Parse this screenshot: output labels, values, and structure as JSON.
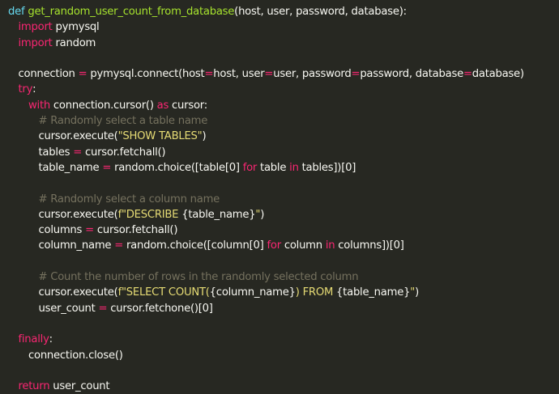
{
  "colors": {
    "background": "#272822",
    "plain": "#f8f8f2",
    "keyword": "#f92672",
    "function": "#a6e22e",
    "string": "#e6db74",
    "comment": "#75715e",
    "def_keyword": "#66d9ef"
  },
  "code": {
    "lines": [
      {
        "indent": 0,
        "tokens": [
          {
            "t": "def",
            "c": "def"
          },
          {
            "t": " ",
            "c": "pl"
          },
          {
            "t": "get_random_user_count_from_database",
            "c": "fn"
          },
          {
            "t": "(host, user, password, database):",
            "c": "pl"
          }
        ]
      },
      {
        "indent": 1,
        "tokens": [
          {
            "t": "import",
            "c": "kw"
          },
          {
            "t": " pymysql",
            "c": "pl"
          }
        ]
      },
      {
        "indent": 1,
        "tokens": [
          {
            "t": "import",
            "c": "kw"
          },
          {
            "t": " random",
            "c": "pl"
          }
        ]
      },
      {
        "indent": 0,
        "tokens": []
      },
      {
        "indent": 1,
        "tokens": [
          {
            "t": "connection ",
            "c": "pl"
          },
          {
            "t": "=",
            "c": "kw"
          },
          {
            "t": " pymysql.connect(host",
            "c": "pl"
          },
          {
            "t": "=",
            "c": "kw"
          },
          {
            "t": "host, user",
            "c": "pl"
          },
          {
            "t": "=",
            "c": "kw"
          },
          {
            "t": "user, password",
            "c": "pl"
          },
          {
            "t": "=",
            "c": "kw"
          },
          {
            "t": "password, database",
            "c": "pl"
          },
          {
            "t": "=",
            "c": "kw"
          },
          {
            "t": "database)",
            "c": "pl"
          }
        ]
      },
      {
        "indent": 1,
        "tokens": [
          {
            "t": "try",
            "c": "kw"
          },
          {
            "t": ":",
            "c": "pl"
          }
        ]
      },
      {
        "indent": 2,
        "tokens": [
          {
            "t": "with",
            "c": "kw"
          },
          {
            "t": " connection.cursor() ",
            "c": "pl"
          },
          {
            "t": "as",
            "c": "kw"
          },
          {
            "t": " cursor:",
            "c": "pl"
          }
        ]
      },
      {
        "indent": 3,
        "tokens": [
          {
            "t": "# Randomly select a table name",
            "c": "com"
          }
        ]
      },
      {
        "indent": 3,
        "tokens": [
          {
            "t": "cursor.execute(",
            "c": "pl"
          },
          {
            "t": "\"SHOW TABLES\"",
            "c": "str"
          },
          {
            "t": ")",
            "c": "pl"
          }
        ]
      },
      {
        "indent": 3,
        "tokens": [
          {
            "t": "tables ",
            "c": "pl"
          },
          {
            "t": "=",
            "c": "kw"
          },
          {
            "t": " cursor.fetchall()",
            "c": "pl"
          }
        ]
      },
      {
        "indent": 3,
        "tokens": [
          {
            "t": "table_name ",
            "c": "pl"
          },
          {
            "t": "=",
            "c": "kw"
          },
          {
            "t": " random.choice([table[0] ",
            "c": "pl"
          },
          {
            "t": "for",
            "c": "kw"
          },
          {
            "t": " table ",
            "c": "pl"
          },
          {
            "t": "in",
            "c": "kw"
          },
          {
            "t": " tables])[0]",
            "c": "pl"
          }
        ]
      },
      {
        "indent": 0,
        "tokens": []
      },
      {
        "indent": 3,
        "tokens": [
          {
            "t": "# Randomly select a column name",
            "c": "com"
          }
        ]
      },
      {
        "indent": 3,
        "tokens": [
          {
            "t": "cursor.execute(",
            "c": "pl"
          },
          {
            "t": "f\"DESCRIBE ",
            "c": "str"
          },
          {
            "t": "{table_name}",
            "c": "pl"
          },
          {
            "t": "\"",
            "c": "str"
          },
          {
            "t": ")",
            "c": "pl"
          }
        ]
      },
      {
        "indent": 3,
        "tokens": [
          {
            "t": "columns ",
            "c": "pl"
          },
          {
            "t": "=",
            "c": "kw"
          },
          {
            "t": " cursor.fetchall()",
            "c": "pl"
          }
        ]
      },
      {
        "indent": 3,
        "tokens": [
          {
            "t": "column_name ",
            "c": "pl"
          },
          {
            "t": "=",
            "c": "kw"
          },
          {
            "t": " random.choice([column[0] ",
            "c": "pl"
          },
          {
            "t": "for",
            "c": "kw"
          },
          {
            "t": " column ",
            "c": "pl"
          },
          {
            "t": "in",
            "c": "kw"
          },
          {
            "t": " columns])[0]",
            "c": "pl"
          }
        ]
      },
      {
        "indent": 0,
        "tokens": []
      },
      {
        "indent": 3,
        "tokens": [
          {
            "t": "# Count the number of rows in the randomly selected column",
            "c": "com"
          }
        ]
      },
      {
        "indent": 3,
        "tokens": [
          {
            "t": "cursor.execute(",
            "c": "pl"
          },
          {
            "t": "f\"SELECT COUNT(",
            "c": "str"
          },
          {
            "t": "{column_name}",
            "c": "pl"
          },
          {
            "t": ") FROM ",
            "c": "str"
          },
          {
            "t": "{table_name}",
            "c": "pl"
          },
          {
            "t": "\"",
            "c": "str"
          },
          {
            "t": ")",
            "c": "pl"
          }
        ]
      },
      {
        "indent": 3,
        "tokens": [
          {
            "t": "user_count ",
            "c": "pl"
          },
          {
            "t": "=",
            "c": "kw"
          },
          {
            "t": " cursor.fetchone()[0]",
            "c": "pl"
          }
        ]
      },
      {
        "indent": 0,
        "tokens": []
      },
      {
        "indent": 1,
        "tokens": [
          {
            "t": "finally",
            "c": "kw"
          },
          {
            "t": ":",
            "c": "pl"
          }
        ]
      },
      {
        "indent": 2,
        "tokens": [
          {
            "t": "connection.close()",
            "c": "pl"
          }
        ]
      },
      {
        "indent": 0,
        "tokens": []
      },
      {
        "indent": 1,
        "tokens": [
          {
            "t": "return",
            "c": "kw"
          },
          {
            "t": " user_count",
            "c": "pl"
          }
        ]
      }
    ]
  }
}
